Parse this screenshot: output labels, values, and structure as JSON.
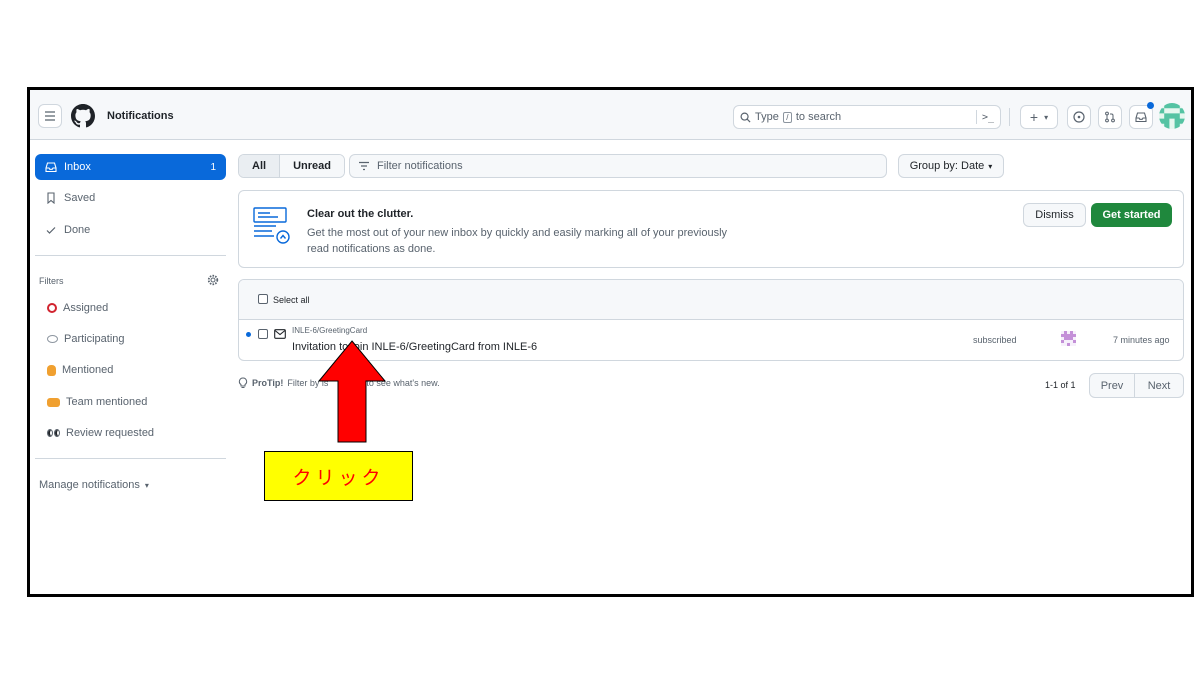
{
  "header": {
    "title": "Notifications",
    "search_placeholder_pre": "Type",
    "search_key": "/",
    "search_placeholder_post": "to search",
    "terminal_label": ">_",
    "plus_label": "+",
    "plus_caret": "▾"
  },
  "sidebar": {
    "inbox": {
      "label": "Inbox",
      "count": "1"
    },
    "saved": "Saved",
    "done": "Done",
    "filters_title": "Filters",
    "filters": [
      "Assigned",
      "Participating",
      "Mentioned",
      "Team mentioned",
      "Review requested"
    ],
    "manage": "Manage notifications",
    "manage_caret": "▾"
  },
  "toolbar": {
    "all": "All",
    "unread": "Unread",
    "filter_placeholder": "Filter notifications",
    "group_by": "Group by: Date",
    "group_caret": "▾"
  },
  "banner": {
    "title": "Clear out the clutter.",
    "text": "Get the most out of your new inbox by quickly and easily marking all of your previously read notifications as done.",
    "dismiss": "Dismiss",
    "get_started": "Get started"
  },
  "list": {
    "select_all": "Select all",
    "items": [
      {
        "repo": "INLE-6/GreetingCard",
        "title": "Invitation to join INLE-6/GreetingCard from INLE-6",
        "reason": "subscribed",
        "time": "7 minutes ago"
      }
    ]
  },
  "footer": {
    "protip_label": "ProTip!",
    "protip_text_a": "Filter by is",
    "protip_text_b": "to see what's new.",
    "page_info": "1-1 of 1",
    "prev": "Prev",
    "next": "Next"
  },
  "annotation": {
    "callout": "クリック"
  },
  "colors": {
    "accent": "#0969da",
    "primary_button": "#1f883d",
    "arrow": "#ff0000",
    "callout_bg": "#ffff00"
  }
}
